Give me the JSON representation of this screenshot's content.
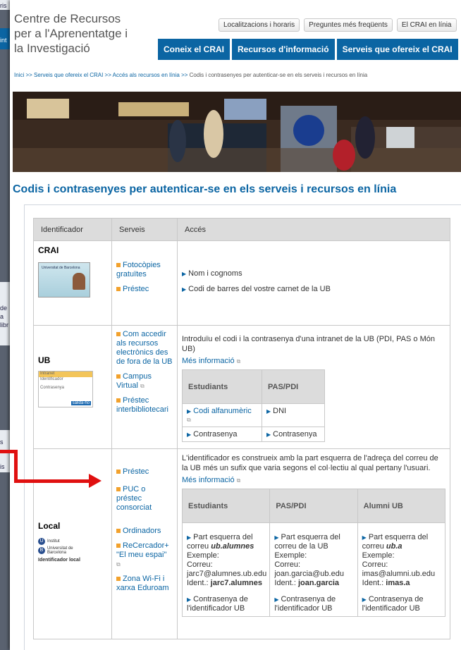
{
  "bg": {
    "left_texts": [
      "ris",
      "int",
      "de",
      "a",
      "libr",
      "s",
      "is"
    ]
  },
  "logo": {
    "line1": "Centre de Recursos",
    "line2": "per a l'Aprenentatge i",
    "line3": "la Investigació"
  },
  "toplinks": [
    "Localitzacions i horaris",
    "Preguntes més freqüents",
    "El CRAI en línia"
  ],
  "mainnav": [
    "Coneix el CRAI",
    "Recursos d'informació",
    "Serveis que ofereix el CRAI"
  ],
  "breadcrumb": {
    "items": [
      "Inici",
      "Serveis que ofereix el CRAI",
      "Accés als recursos en línia"
    ],
    "sep": ">>",
    "current": "Codis i contrasenyes per autenticar-se en els serveis i recursos en línia"
  },
  "page_title": "Codis i contrasenyes per autenticar-se en els serveis i recursos en línia",
  "table": {
    "headers": [
      "Identificador",
      "Serveis",
      "Accés"
    ],
    "crai": {
      "id": "CRAI",
      "card_text": "Universitat de Barcelona",
      "services": [
        "Fotocòpies gratuïtes",
        "Préstec"
      ],
      "access": [
        "Nom i cognoms",
        "Codi de barres del vostre carnet de la UB"
      ]
    },
    "ub": {
      "id": "UB",
      "intranet": {
        "title": "Intranet",
        "id_label": "Identificador",
        "pw_label": "Contrasenya",
        "button": "salida-ho"
      },
      "services": [
        "Com accedir als recursos electrònics des de fora de la UB",
        "Campus Virtual",
        "Préstec interbibliotecari"
      ],
      "intro": "Introduïu el codi i la contrasenya d'una intranet de la UB (PDI, PAS o Món UB)",
      "more": "Més informació",
      "sub_headers": [
        "Estudiants",
        "PAS/PDI"
      ],
      "sub_rows": [
        [
          "Codi alfanumèric",
          "DNI"
        ],
        [
          "Contrasenya",
          "Contrasenya"
        ]
      ]
    },
    "local": {
      "id": "Local",
      "logo_line1": "Institut",
      "logo_line2": "Universitat de Barcelona",
      "logo_caption": "Identificador local",
      "services": [
        "Préstec",
        "PUC o préstec consorciat",
        "Ordinadors",
        "ReCercador+ \"El meu espai\"",
        "Zona Wi-Fi i xarxa Eduroam"
      ],
      "intro": "L'identificador es construeix amb la part esquerra de l'adreça del correu de la UB més un sufix que varia segons el col·lectiu al qual pertany l'usuari.",
      "more": "Més informació",
      "sub_headers": [
        "Estudiants",
        "PAS/PDI",
        "Alumni UB"
      ],
      "cols": [
        {
          "p1": "Part esquerra del correu ",
          "suffix": "ub.alumnes",
          "ex": "Exemple:",
          "mail_label": "Correu:",
          "mail": "jarc7@alumnes.ub.edu",
          "ident_label": "Ident.:",
          "ident": "jarc7.alumnes",
          "pw": "Contrasenya de l'identificador UB"
        },
        {
          "p1": "Part esquerra del correu de la UB",
          "suffix": "",
          "ex": "Exemple:",
          "mail_label": "Correu:",
          "mail": "joan.garcia@ub.edu",
          "ident_label": "Ident.:",
          "ident": "joan.garcia",
          "pw": "Contrasenya de l'identificador UB"
        },
        {
          "p1": "Part esquerra del correu ",
          "suffix": "ub.a",
          "ex": "Exemple:",
          "mail_label": "Correu:",
          "mail": "imas@alumni.ub.edu",
          "ident_label": "Ident.:",
          "ident": "imas.a",
          "pw": "Contrasenya de l'identificador UB"
        }
      ]
    }
  },
  "colors": {
    "accent": "#0b65a3",
    "bullet": "#f2a12c",
    "arrow": "#e01010"
  }
}
